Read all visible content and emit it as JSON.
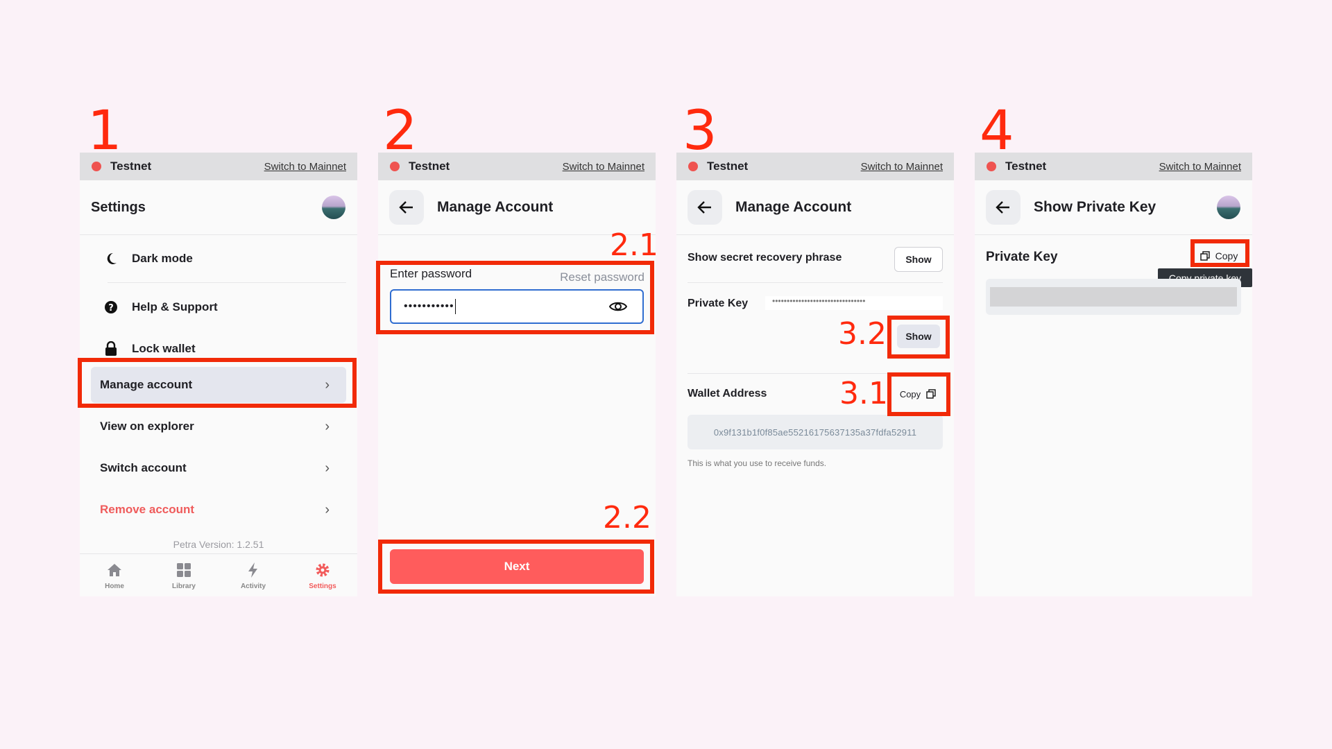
{
  "steps": {
    "s1": "1",
    "s2": "2",
    "s3": "3",
    "s4": "4",
    "a21": "2.1",
    "a22": "2.2",
    "a31": "3.1",
    "a32": "3.2"
  },
  "network": {
    "name": "Testnet",
    "switch_label": "Switch to Mainnet"
  },
  "panel1": {
    "title": "Settings",
    "items": [
      {
        "label": "Dark mode",
        "icon": "moon-icon"
      },
      {
        "label": "Help & Support",
        "icon": "help-icon"
      },
      {
        "label": "Lock wallet",
        "icon": "lock-icon"
      }
    ],
    "nav": [
      {
        "label": "Manage account"
      },
      {
        "label": "View on explorer"
      },
      {
        "label": "Switch account"
      },
      {
        "label": "Remove account"
      }
    ],
    "version": "Petra Version: 1.2.51",
    "tabs": [
      {
        "label": "Home",
        "icon": "home-icon"
      },
      {
        "label": "Library",
        "icon": "grid-icon"
      },
      {
        "label": "Activity",
        "icon": "bolt-icon"
      },
      {
        "label": "Settings",
        "icon": "gear-icon"
      }
    ]
  },
  "panel2": {
    "title": "Manage Account",
    "password_label": "Enter password",
    "reset_label": "Reset password",
    "password_value": "•••••••••••",
    "next_label": "Next"
  },
  "panel3": {
    "title": "Manage Account",
    "recovery_label": "Show secret recovery phrase",
    "show_label": "Show",
    "private_key_label": "Private Key",
    "private_key_mask": "••••••••••••••••••••••••••••••••",
    "show_key_label": "Show",
    "wallet_label": "Wallet Address",
    "copy_label": "Copy",
    "wallet_address": "0x9f131b1f0f85ae55216175637135a37fdfa52911",
    "helper": "This is what you use to receive funds."
  },
  "panel4": {
    "title": "Show Private Key",
    "private_key_label": "Private Key",
    "copy_label": "Copy",
    "tooltip": "Copy private key"
  },
  "colors": {
    "accent": "#ff5c5c",
    "annotation": "#f12a08",
    "remove": "#ef5b5b"
  }
}
